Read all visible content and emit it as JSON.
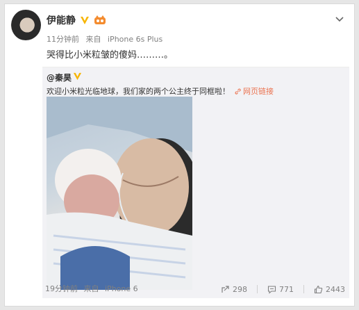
{
  "post": {
    "author": "伊能静",
    "time": "11分钟前",
    "source_prefix": "来自",
    "source": "iPhone 6s Plus",
    "text": "哭得比小米粒皱的傻妈………。"
  },
  "repost": {
    "author": "@秦昊",
    "text": "欢迎小米粒光临地球，我们家的两个公主终于同框啦！",
    "link_label": "网页链接",
    "time": "19分钟前",
    "source_prefix": "来自",
    "source": "iPhone 6",
    "actions": {
      "share_count": "298",
      "comment_count": "771",
      "like_count": "2443"
    }
  },
  "colors": {
    "link": "#eb7350",
    "vip": "#f7b500",
    "meta_text": "#808080"
  },
  "icons": [
    "avatar",
    "vip-v-icon",
    "member-icon",
    "chevron-down-icon",
    "link-icon",
    "share-icon",
    "comment-icon",
    "like-icon"
  ]
}
